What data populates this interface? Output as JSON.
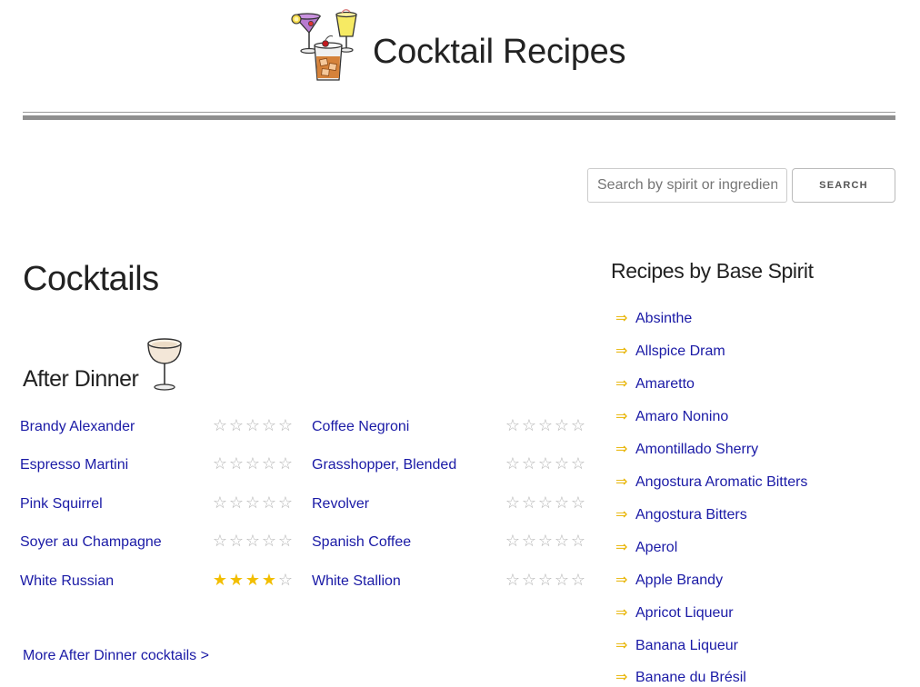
{
  "header": {
    "site_title": "Cocktail Recipes",
    "logo_icon": "cocktail-glasses-icon"
  },
  "search": {
    "placeholder": "Search by spirit or ingredient",
    "button_label": "SEARCH"
  },
  "main": {
    "page_heading": "Cocktails",
    "section": {
      "heading": "After Dinner",
      "icon": "coupe-glass-icon",
      "rows": [
        {
          "left": {
            "name": "Brandy Alexander",
            "rating": 0
          },
          "right": {
            "name": "Coffee Negroni",
            "rating": 0
          }
        },
        {
          "left": {
            "name": "Espresso Martini",
            "rating": 0
          },
          "right": {
            "name": "Grasshopper, Blended",
            "rating": 0
          }
        },
        {
          "left": {
            "name": "Pink Squirrel",
            "rating": 0
          },
          "right": {
            "name": "Revolver",
            "rating": 0
          }
        },
        {
          "left": {
            "name": "Soyer au Champagne",
            "rating": 0
          },
          "right": {
            "name": "Spanish Coffee",
            "rating": 0
          }
        },
        {
          "left": {
            "name": "White Russian",
            "rating": 4
          },
          "right": {
            "name": "White Stallion",
            "rating": 0
          }
        }
      ],
      "more_link": "More After Dinner cocktails >"
    }
  },
  "sidebar": {
    "heading": "Recipes by Base Spirit",
    "arrow_glyph": "⇒",
    "spirits": [
      "Absinthe",
      "Allspice Dram",
      "Amaretto",
      "Amaro Nonino",
      "Amontillado Sherry",
      "Angostura Aromatic Bitters",
      "Angostura Bitters",
      "Aperol",
      "Apple Brandy",
      "Apricot Liqueur",
      "Banana Liqueur",
      "Banane du Brésil"
    ]
  },
  "colors": {
    "link": "#1a1aa6",
    "star_on": "#f2be00",
    "star_off": "#b5b5b5",
    "arrow": "#e8b400"
  }
}
